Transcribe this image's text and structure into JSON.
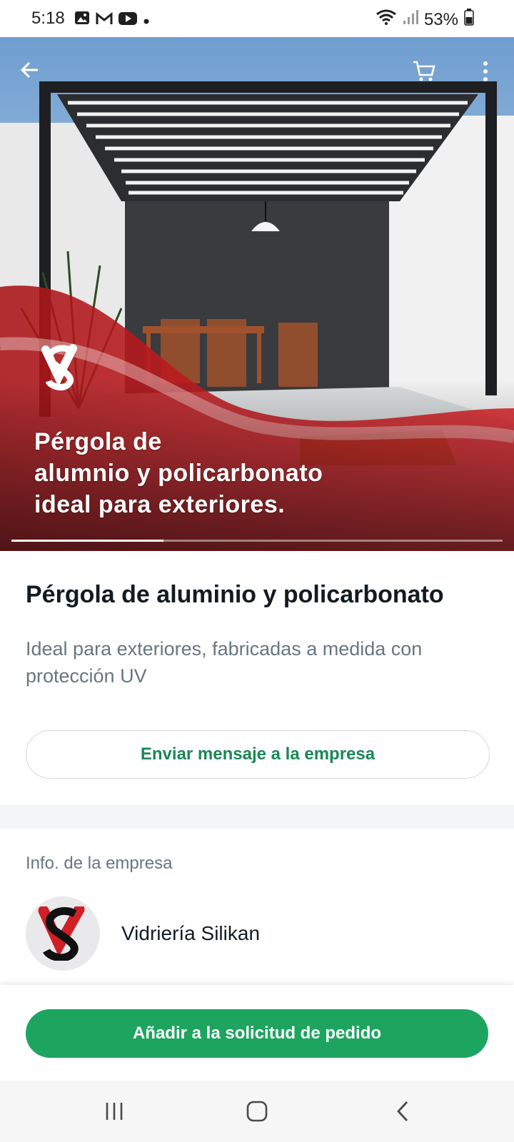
{
  "status_bar": {
    "time": "5:18",
    "battery": "53%",
    "notification_icons": [
      "gallery-icon",
      "gmail-icon",
      "youtube-icon",
      "dot-icon"
    ]
  },
  "hero": {
    "caption_lines": [
      "Pérgola de",
      "alumnio y policarbonato",
      "ideal para exteriores."
    ],
    "carousel_progress": 0.31
  },
  "product": {
    "title": "Pérgola de aluminio y policarbonato",
    "description": "Ideal para exteriores, fabricadas a medida con protección UV",
    "message_button": "Enviar mensaje a la empresa"
  },
  "company": {
    "section_label": "Info. de la empresa",
    "name": "Vidriería Silikan"
  },
  "footer": {
    "cta_label": "Añadir a la solicitud de pedido"
  },
  "colors": {
    "accent_green": "#1da560",
    "text_green": "#1b8755",
    "brand_red": "#d11f26"
  }
}
